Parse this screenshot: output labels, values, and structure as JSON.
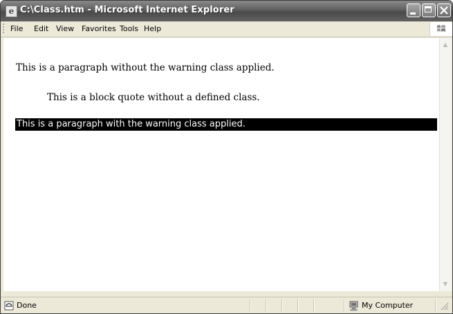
{
  "window": {
    "title": "C:\\Class.htm - Microsoft Internet Explorer"
  },
  "menu": {
    "items": [
      "File",
      "Edit",
      "View",
      "Favorites",
      "Tools",
      "Help"
    ]
  },
  "content": {
    "paragraph_plain": "This is a paragraph without the warning class applied.",
    "blockquote": "This is a block quote without a defined class.",
    "paragraph_warning": "This is a paragraph with the warning class applied.",
    "warning_style": {
      "background": "#000000",
      "color": "#ffffff"
    }
  },
  "status": {
    "text": "Done",
    "zone": "My Computer"
  },
  "icons": {
    "title": "ie-page-icon",
    "throbber": "windows-logo-icon",
    "status": "page-done-icon",
    "zone": "my-computer-icon"
  }
}
